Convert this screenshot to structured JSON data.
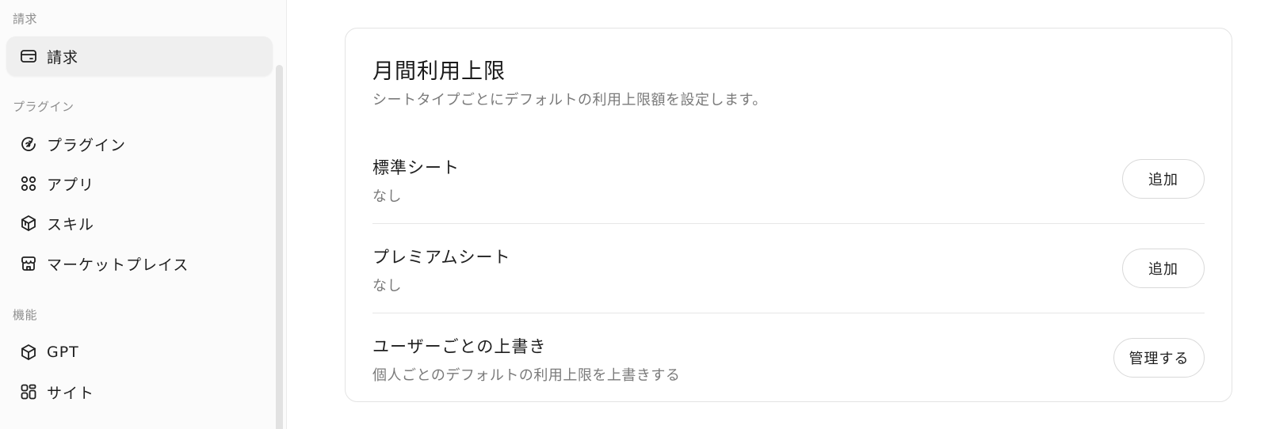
{
  "sidebar": {
    "sections": [
      {
        "label": "請求"
      },
      {
        "label": "プラグイン"
      },
      {
        "label": "機能"
      }
    ],
    "items": [
      {
        "label": "請求",
        "icon": "card-icon",
        "active": true
      },
      {
        "label": "プラグイン",
        "icon": "plugin-icon"
      },
      {
        "label": "アプリ",
        "icon": "apps-icon"
      },
      {
        "label": "スキル",
        "icon": "skill-icon"
      },
      {
        "label": "マーケットプレイス",
        "icon": "store-icon"
      },
      {
        "label": "GPT",
        "icon": "cube-icon"
      },
      {
        "label": "サイト",
        "icon": "site-icon"
      }
    ]
  },
  "card": {
    "title": "月間利用上限",
    "description": "シートタイプごとにデフォルトの利用上限額を設定します。",
    "rows": [
      {
        "title": "標準シート",
        "subtitle": "なし",
        "button": "追加"
      },
      {
        "title": "プレミアムシート",
        "subtitle": "なし",
        "button": "追加"
      },
      {
        "title": "ユーザーごとの上書き",
        "subtitle": "個人ごとのデフォルトの利用上限を上書きする",
        "button": "管理する"
      }
    ]
  }
}
